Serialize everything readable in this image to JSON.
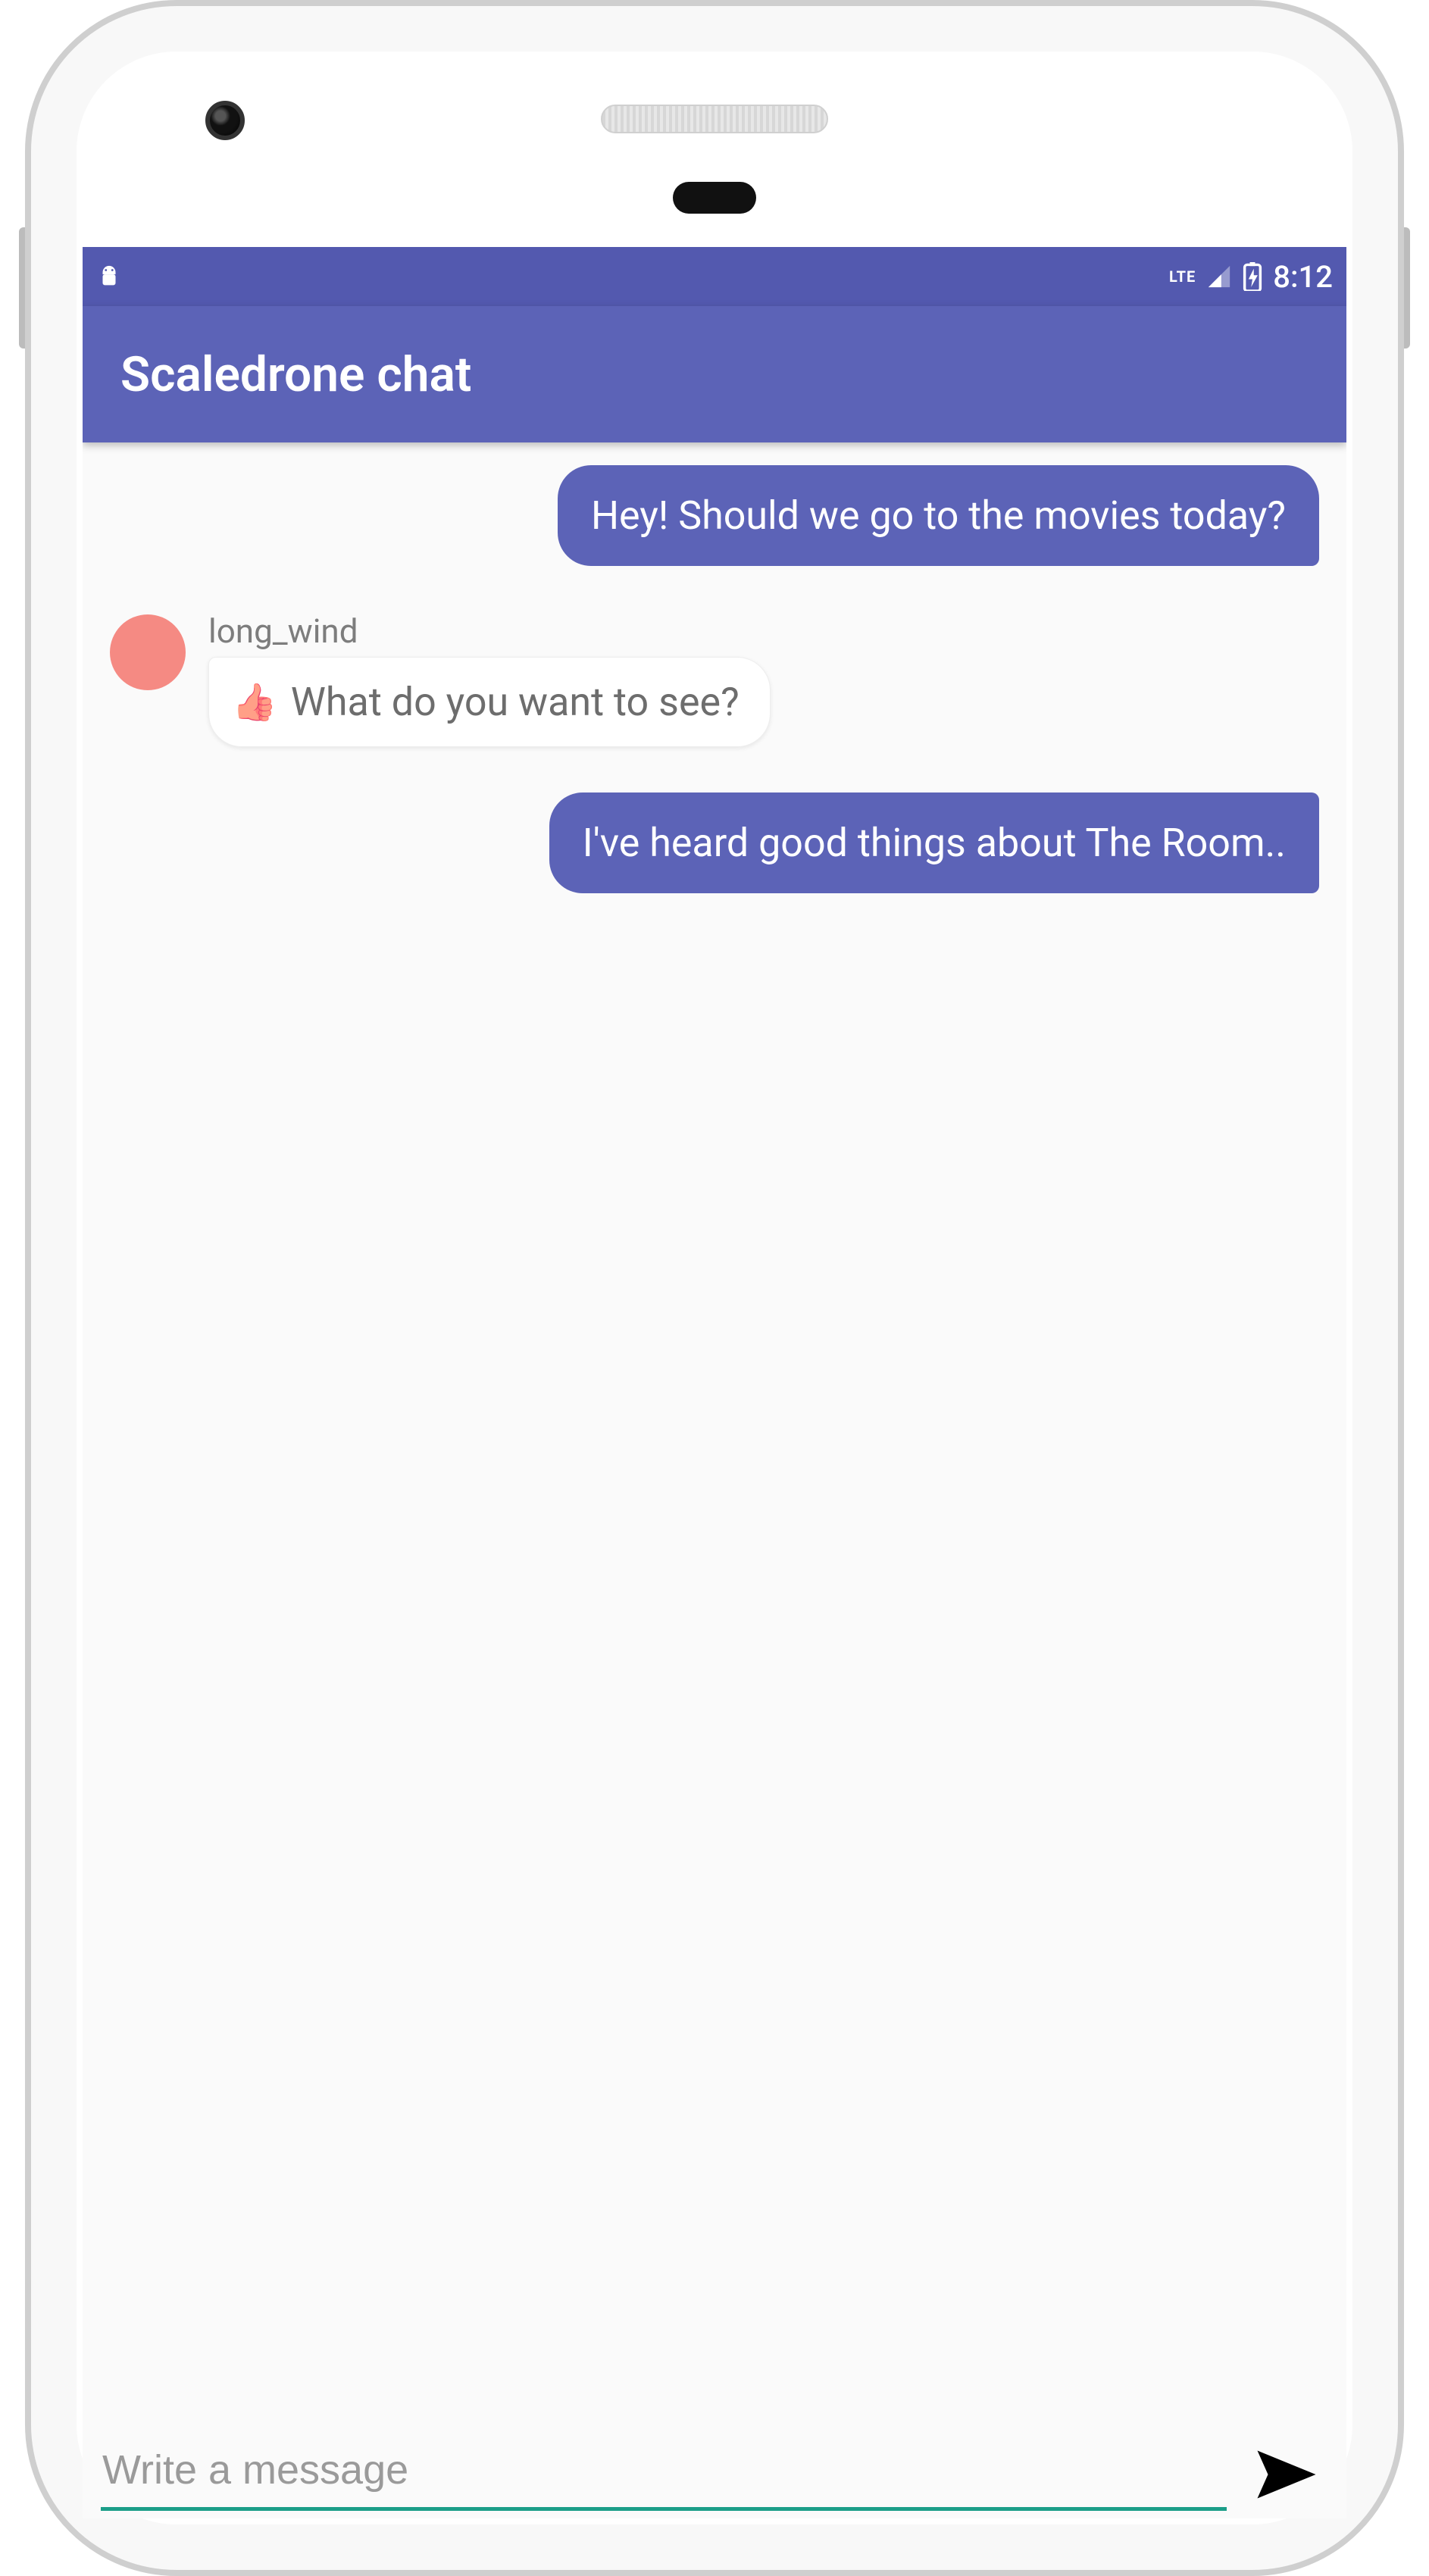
{
  "colors": {
    "status_bar": "#5359af",
    "app_bar": "#5c63b7",
    "bubble_out_bg": "#5c63b7",
    "bubble_out_fg": "#ffffff",
    "bubble_in_bg": "#ffffff",
    "bubble_in_fg": "#6d6d6d",
    "avatar": "#f58a83",
    "input_underline": "#1b9e88",
    "send_icon": "#000000"
  },
  "status": {
    "network_label": "LTE",
    "time": "8:12"
  },
  "appbar": {
    "title": "Scaledrone chat"
  },
  "chat": {
    "messages": [
      {
        "kind": "out",
        "text": "Hey! Should we go to the movies today?"
      },
      {
        "kind": "in",
        "sender": "long_wind",
        "avatar_color": "#f58a83",
        "icon": "thumbs-up",
        "text": "What do you want to see?"
      },
      {
        "kind": "out",
        "text": "I've heard good things about The Room.."
      }
    ]
  },
  "composer": {
    "placeholder": "Write a message",
    "value": "",
    "send_icon": "send"
  }
}
